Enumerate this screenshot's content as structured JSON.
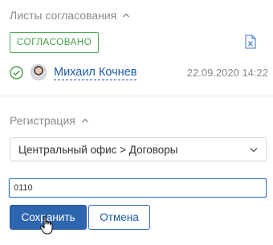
{
  "approval": {
    "title": "Листы согласования",
    "status_badge": "СОГЛАСОВАНО",
    "approver_name": "Михаил Кочнев",
    "approval_date": "22.09.2020 14:22",
    "status_color": "#43a047",
    "file_icon": "excel-file-icon"
  },
  "registration": {
    "title": "Регистрация",
    "category_value": "Центральный офис > Договоры",
    "number_value": "0110"
  },
  "actions": {
    "save_label": "Сохранить",
    "cancel_label": "Отмена",
    "primary_color": "#2d65ae"
  }
}
